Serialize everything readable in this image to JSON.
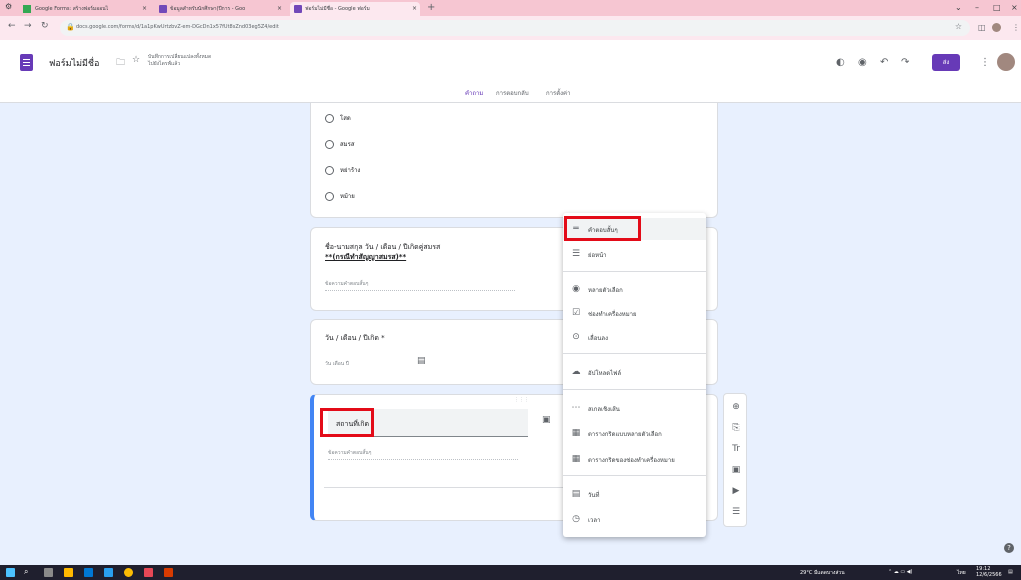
{
  "browser": {
    "tabs": [
      {
        "label": "Google Forms: สร้างฟอร์มออนไ"
      },
      {
        "label": "ข้อมูลสำหรับนักศึกษา(ปีการ - Goo"
      },
      {
        "label": "ฟอร์มไม่มีชื่อ - Google ฟอร์ม"
      }
    ],
    "url": "docs.google.com/forms/d/1a1pKwUrtzbvZ-em-DGcDn1x57fUt8sZnd03eg5Z4/edit",
    "window_controls": {
      "minimize": "–",
      "maximize": "□",
      "close": "×"
    }
  },
  "forms_header": {
    "title": "ฟอร์มไม่มีชื่อ",
    "save_status_line1": "บันทึกการเปลี่ยนแปลงทั้งหมด",
    "save_status_line2": "ไปยังไดรฟ์แล้ว",
    "send_label": "ส่ง",
    "tabs": [
      {
        "label": "คำถาม"
      },
      {
        "label": "การตอบกลับ"
      },
      {
        "label": "การตั้งค่า"
      }
    ]
  },
  "options_card": {
    "options": [
      {
        "label": "โสด"
      },
      {
        "label": "สมรส"
      },
      {
        "label": "หย่าร้าง"
      },
      {
        "label": "หม้าย"
      }
    ]
  },
  "spouse_card": {
    "title_line1": "ชื่อ-นามสกุล วัน / เดือน / ปีเกิดคู่สมรส",
    "title_line2": "**(กรณีทำสัญญาสมรส)**",
    "answer_placeholder": "ข้อความคำตอบสั้นๆ"
  },
  "date_card": {
    "title": "วัน / เดือน / ปีเกิด *",
    "placeholder": "วัน เดือน ปี"
  },
  "active_card": {
    "question_title": "สถานที่เกิด",
    "answer_placeholder": "ข้อความคำตอบสั้นๆ"
  },
  "question_type_menu": {
    "items": [
      {
        "label": "คำตอบสั้นๆ",
        "icon": "short-text-icon",
        "glyph": "═"
      },
      {
        "label": "ย่อหน้า",
        "icon": "paragraph-icon",
        "glyph": "☰"
      },
      {
        "label": "หลายตัวเลือก",
        "icon": "radio-icon",
        "glyph": "◉"
      },
      {
        "label": "ช่องทำเครื่องหมาย",
        "icon": "checkbox-icon",
        "glyph": "☑"
      },
      {
        "label": "เลื่อนลง",
        "icon": "dropdown-icon",
        "glyph": "⊙"
      },
      {
        "label": "อัปโหลดไฟล์",
        "icon": "cloud-upload-icon",
        "glyph": "☁"
      },
      {
        "label": "สเกลเชิงเส้น",
        "icon": "linear-scale-icon",
        "glyph": "⋯"
      },
      {
        "label": "ตารางกริดแบบหลายตัวเลือก",
        "icon": "grid-icon",
        "glyph": "▦"
      },
      {
        "label": "ตารางกริดของช่องทำเครื่องหมาย",
        "icon": "grid-checkbox-icon",
        "glyph": "▦"
      },
      {
        "label": "วันที่",
        "icon": "calendar-icon",
        "glyph": "▤"
      },
      {
        "label": "เวลา",
        "icon": "clock-icon",
        "glyph": "◷"
      }
    ]
  },
  "side_toolbar": {
    "items": [
      {
        "icon": "add-question-icon",
        "glyph": "⊕"
      },
      {
        "icon": "import-questions-icon",
        "glyph": "⎘"
      },
      {
        "icon": "add-title-icon",
        "glyph": "Tr"
      },
      {
        "icon": "add-image-icon",
        "glyph": "▣"
      },
      {
        "icon": "add-video-icon",
        "glyph": "▶"
      },
      {
        "icon": "add-section-icon",
        "glyph": "☰"
      }
    ]
  },
  "taskbar": {
    "weather": "29°C มีแดดบางส่วน",
    "lang": "ไทย",
    "time": "19:12",
    "date": "12/6/2566"
  },
  "colors": {
    "accent": "#673ab7",
    "highlight_box": "#e30b18",
    "background": "#e8f0fe"
  }
}
